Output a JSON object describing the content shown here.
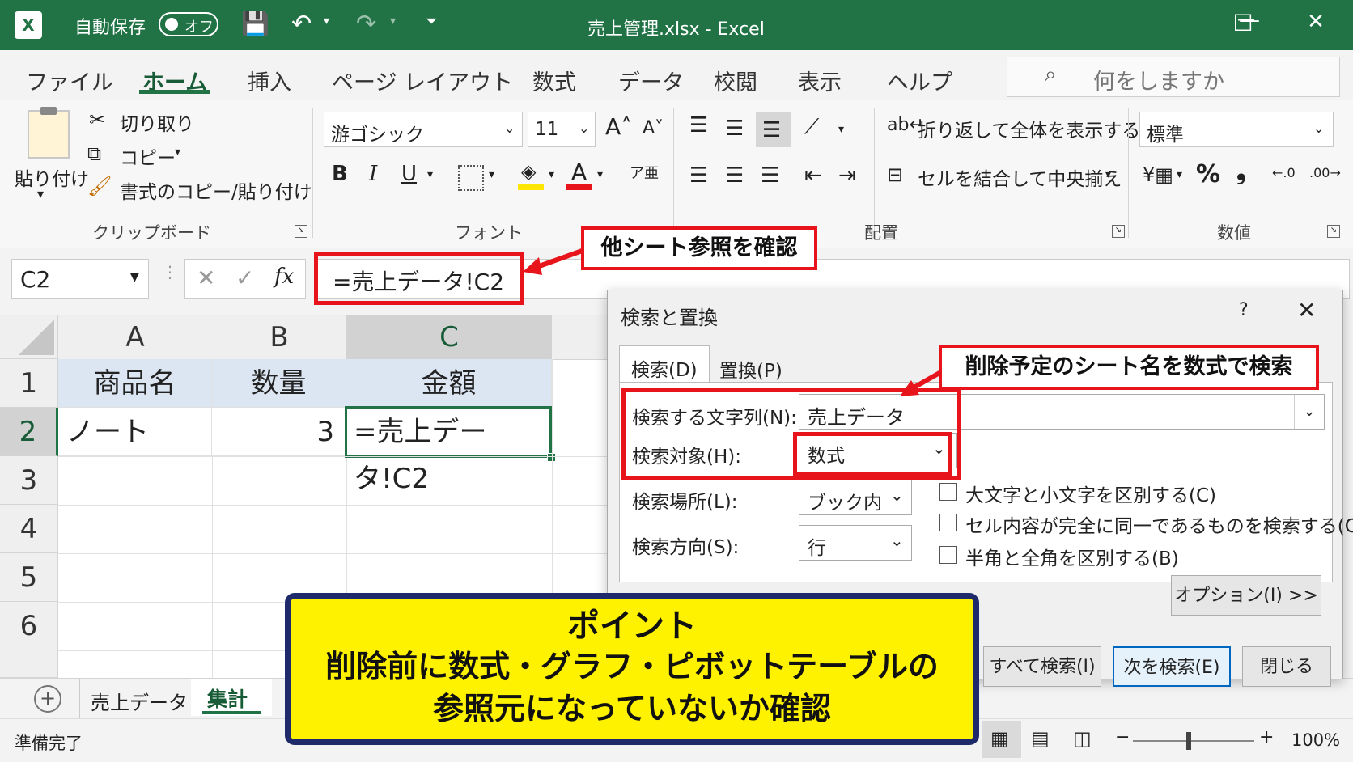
{
  "titlebar": {
    "autosave_label": "自動保存",
    "autosave_state": "オフ",
    "window_title": "売上管理.xlsx  -  Excel",
    "minimize": "—",
    "maximize": "☐",
    "close": "✕"
  },
  "menu": {
    "tabs": [
      "ファイル",
      "ホーム",
      "挿入",
      "ページ レイアウト",
      "数式",
      "データ",
      "校閲",
      "表示",
      "ヘルプ"
    ],
    "active": "ホーム",
    "search_placeholder": "何をしますか"
  },
  "ribbon": {
    "clipboard": {
      "paste": "貼り付け",
      "cut": "切り取り",
      "copy": "コピー",
      "format_painter": "書式のコピー/貼り付け",
      "group_label": "クリップボード"
    },
    "font": {
      "font_name": "游ゴシック",
      "font_size": "11",
      "bold": "B",
      "italic": "I",
      "underline": "U",
      "group_label": "フォント",
      "highlight_color": "#ffe600",
      "font_color": "#e8141b"
    },
    "alignment": {
      "wrap_text": "折り返して全体を表示する",
      "merge_center": "セルを結合して中央揃え",
      "group_label": "配置"
    },
    "number": {
      "format": "標準",
      "percent": "%",
      "comma": "❟",
      "group_label": "数値"
    }
  },
  "formula_bar": {
    "name_box": "C2",
    "fx": "fx",
    "formula": "=売上データ!C2"
  },
  "grid": {
    "columns": [
      "A",
      "B",
      "C"
    ],
    "rows": [
      "1",
      "2",
      "3",
      "4",
      "5",
      "6"
    ],
    "header_row": [
      "商品名",
      "数量",
      "金額"
    ],
    "row2": [
      "ノート",
      "3",
      "=売上データ!C2"
    ]
  },
  "sheets": {
    "add": "+",
    "tabs": [
      "売上データ",
      "集計"
    ],
    "active": "集計"
  },
  "status": {
    "ready": "準備完了",
    "zoom": "100%"
  },
  "dialog": {
    "title": "検索と置換",
    "help": "?",
    "close": "✕",
    "tab_search": "検索(D)",
    "tab_replace": "置換(P)",
    "find_label": "検索する文字列(N):",
    "find_value": "売上データ",
    "lookin_label": "検索対象(H):",
    "lookin_value": "数式",
    "within_label": "検索場所(L):",
    "within_value": "ブック内",
    "direction_label": "検索方向(S):",
    "direction_value": "行",
    "opt_case": "大文字と小文字を区別する(C)",
    "opt_entire": "セル内容が完全に同一であるものを検索する(O)",
    "opt_width": "半角と全角を区別する(B)",
    "options_btn": "オプション(I) >>",
    "find_all": "すべて検索(I)",
    "find_next": "次を検索(E)",
    "close_btn": "閉じる"
  },
  "annotations": {
    "callout_formula": "他シート参照を確認",
    "callout_search": "削除予定のシート名を数式で検索",
    "point_title": "ポイント",
    "point_line1": "削除前に数式・グラフ・ピボットテーブルの",
    "point_line2": "参照元になっていないか確認",
    "accent_red": "#e8141b",
    "accent_yellow": "#fff200",
    "excel_green": "#217346"
  }
}
